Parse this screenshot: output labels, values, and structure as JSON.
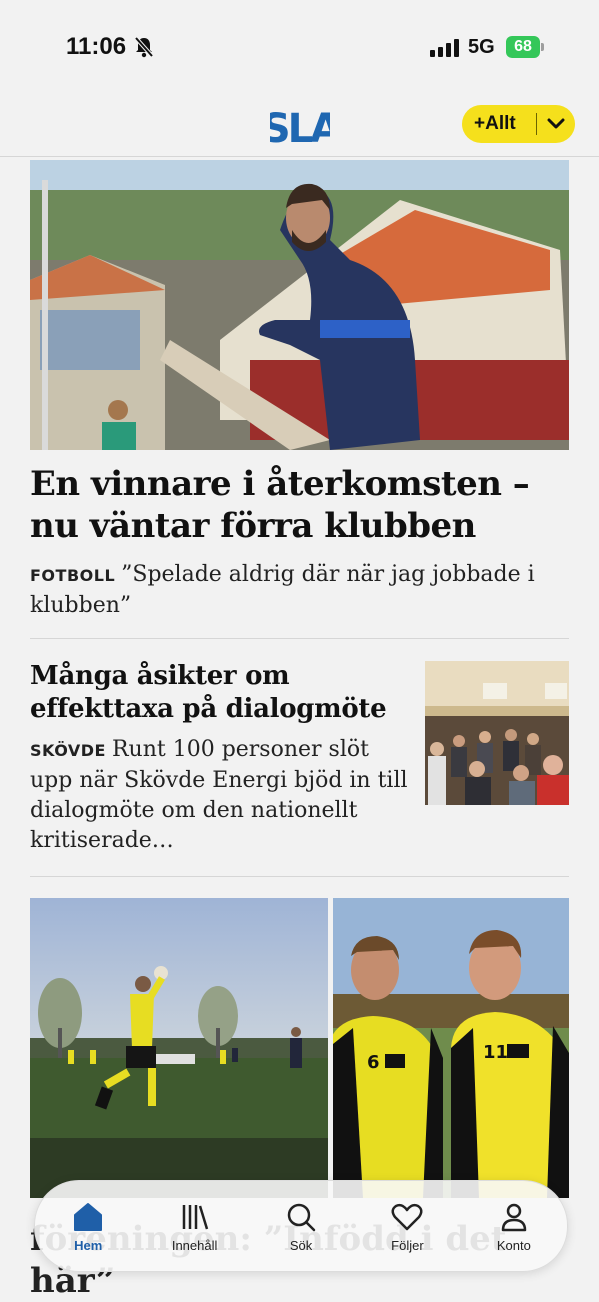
{
  "status_bar": {
    "time": "11:06",
    "network": "5G",
    "battery": "68"
  },
  "header": {
    "logo": "SLA",
    "button_label": "+Allt",
    "colors": {
      "brand": "#1f67b1",
      "accent": "#f5e01c"
    }
  },
  "articles": [
    {
      "headline": "En vinnare i återkomsten – nu väntar förra klubben",
      "kicker": "FOTBOLL",
      "teaser": "”Spelade aldrig där när jag jobbade i klubben”"
    },
    {
      "headline": "Många åsikter om effekttaxa på dialogmöte",
      "kicker": "SKÖVDE",
      "teaser": "Runt 100 personer slöt upp när Skövde Energi bjöd in till dialogmöte om den nationellt kritiserade…"
    },
    {
      "headline": "föreningen: ”Infödd i det här”"
    }
  ],
  "tab_bar": {
    "items": [
      {
        "label": "Hem",
        "icon": "home-icon",
        "active": true
      },
      {
        "label": "Innehåll",
        "icon": "library-icon"
      },
      {
        "label": "Sök",
        "icon": "search-icon"
      },
      {
        "label": "Följer",
        "icon": "heart-icon"
      },
      {
        "label": "Konto",
        "icon": "person-icon"
      }
    ]
  }
}
